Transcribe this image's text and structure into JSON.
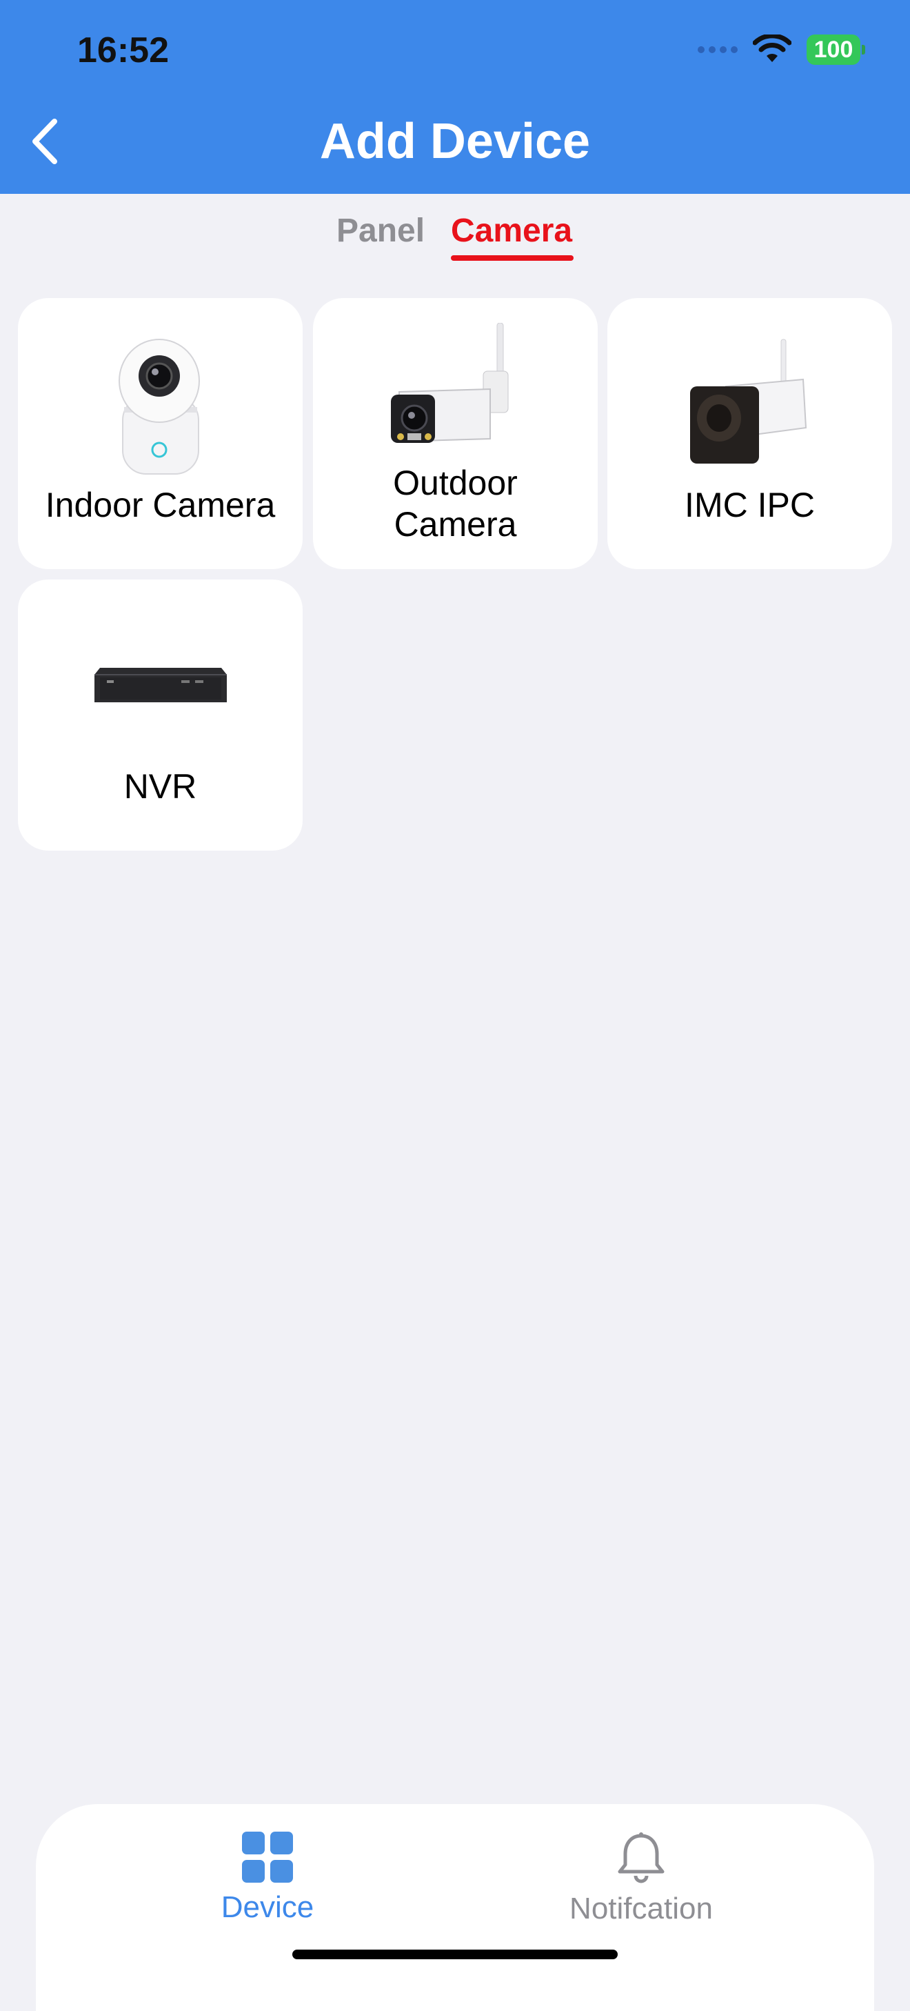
{
  "status_bar": {
    "time": "16:52",
    "battery": "100"
  },
  "header": {
    "title": "Add Device"
  },
  "tabs": [
    {
      "label": "Panel",
      "active": false
    },
    {
      "label": "Camera",
      "active": true
    }
  ],
  "devices": [
    {
      "label": "Indoor Camera"
    },
    {
      "label": "Outdoor\nCamera"
    },
    {
      "label": "IMC IPC"
    },
    {
      "label": "NVR"
    }
  ],
  "tabbar": {
    "device_label": "Device",
    "notification_label": "Notifcation"
  },
  "colors": {
    "header": "#3d88ea",
    "accent": "#e8121b",
    "tab_active": "#3d88ea",
    "tab_inactive": "#8e8e93"
  }
}
